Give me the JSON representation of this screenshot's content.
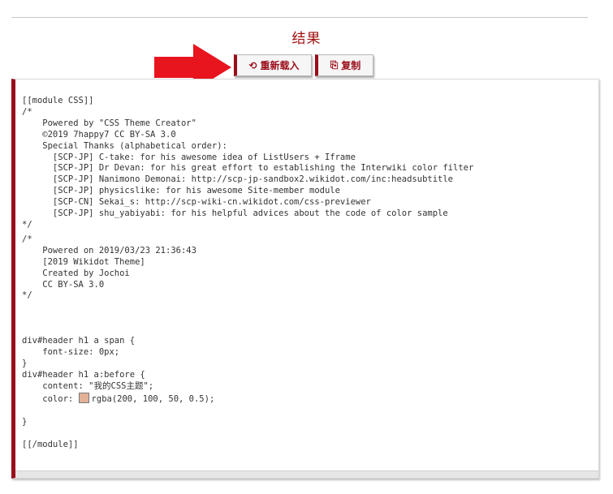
{
  "result": {
    "title": "结果"
  },
  "toolbar": {
    "reload_icon": "⟲",
    "reload_label": "重新载入",
    "copy_icon": "⎘",
    "copy_label": "复制"
  },
  "code": {
    "block1": "[[module CSS]]\n/*\n    Powered by \"CSS Theme Creator\"\n    ©2019 7happy7 CC BY-SA 3.0\n    Special Thanks (alphabetical order):\n      [SCP-JP] C-take: for his awesome idea of ListUsers + Iframe\n      [SCP-JP] Dr Devan: for his great effort to establishing the Interwiki color filter\n      [SCP-JP] Nanimono Demonai: http://scp-jp-sandbox2.wikidot.com/inc:headsubtitle\n      [SCP-JP] physicslike: for his awesome Site-member module\n      [SCP-CN] Sekai_s: http://scp-wiki-cn.wikidot.com/css-previewer\n      [SCP-JP] shu_yabiyabi: for his helpful advices about the code of color sample\n*/",
    "block2": "/*\n    Powered on 2019/03/23 21:36:43\n    [2019 Wikidot Theme]\n    Created by Jochoi\n    CC BY-SA 3.0\n*/",
    "block3": "div#header h1 a span {\n    font-size: 0px;\n}\ndiv#header h1 a:before {\n    content: \"我的CSS主题\";",
    "color_prefix": "    color: ",
    "color_value": "rgba(200, 100, 50, 0.5);",
    "swatch_color": "rgba(200, 100, 50, 0.5)",
    "block4": "}",
    "block5": "[[/module]]"
  },
  "colors": {
    "accent": "#9b0d1a",
    "arrow": "#e8141e",
    "title": "#a01010"
  }
}
